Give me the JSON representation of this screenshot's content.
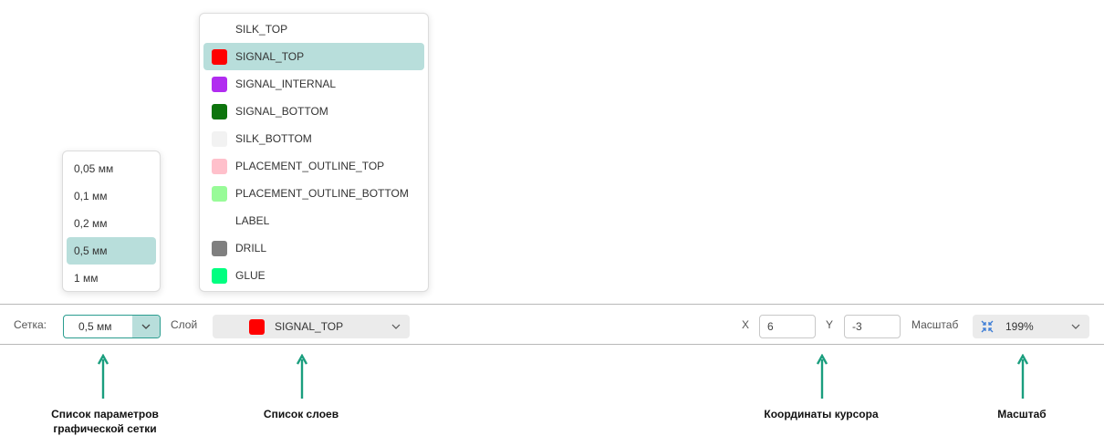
{
  "grid_menu": {
    "options": [
      "0,05 мм",
      "0,1 мм",
      "0,2 мм",
      "0,5 мм",
      "1 мм"
    ],
    "selected_index": 3
  },
  "layer_menu": {
    "options": [
      {
        "label": "SILK_TOP",
        "color": null
      },
      {
        "label": "SIGNAL_TOP",
        "color": "#ff0000"
      },
      {
        "label": "SIGNAL_INTERNAL",
        "color": "#b12cf0"
      },
      {
        "label": "SIGNAL_BOTTOM",
        "color": "#0d740d"
      },
      {
        "label": "SILK_BOTTOM",
        "color": "#f2f2f2"
      },
      {
        "label": "PLACEMENT_OUTLINE_TOP",
        "color": "#ffc0cb"
      },
      {
        "label": "PLACEMENT_OUTLINE_BOTTOM",
        "color": "#98fb98"
      },
      {
        "label": "LABEL",
        "color": null
      },
      {
        "label": "DRILL",
        "color": "#7f7f7f"
      },
      {
        "label": "GLUE",
        "color": "#00ff80"
      }
    ],
    "selected_index": 1
  },
  "toolbar": {
    "grid_label": "Сетка:",
    "grid_value": "0,5 мм",
    "layer_label": "Слой",
    "layer_value": "SIGNAL_TOP",
    "layer_color": "#ff0000",
    "x_label": "X",
    "x_value": "6",
    "y_label": "Y",
    "y_value": "-3",
    "zoom_label": "Масштаб",
    "zoom_value": "199%"
  },
  "annotations": {
    "grid": "Список параметров графической сетки",
    "grid_line1": "Список параметров",
    "grid_line2": "графической сетки",
    "layers": "Список слоев",
    "cursor": "Координаты курсора",
    "zoom": "Масштаб"
  },
  "colors": {
    "accent": "#2a9d8f",
    "selected_bg": "#b8dedb",
    "arrow": "#1a9e7e"
  }
}
